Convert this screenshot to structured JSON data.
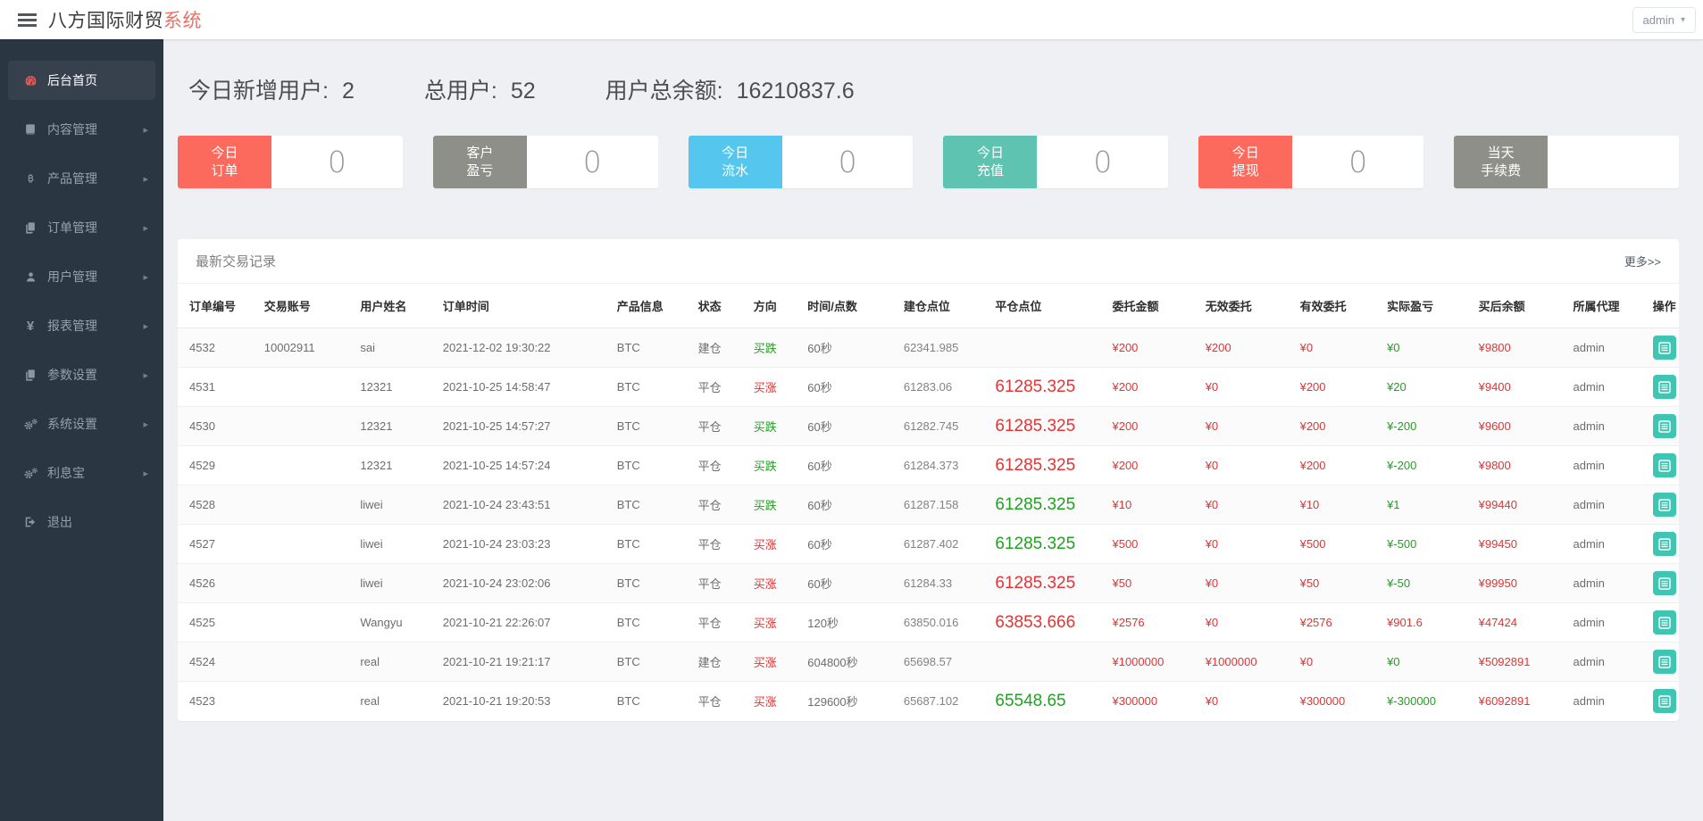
{
  "header": {
    "title_main": "八方国际财贸",
    "title_accent": "系统",
    "user_menu": "admin"
  },
  "sidebar": {
    "items": [
      {
        "id": "dashboard",
        "label": "后台首页",
        "icon": "dashboard-icon",
        "active": true,
        "has_children": false
      },
      {
        "id": "content",
        "label": "内容管理",
        "icon": "book-icon",
        "active": false,
        "has_children": true
      },
      {
        "id": "product",
        "label": "产品管理",
        "icon": "bitcoin-icon",
        "active": false,
        "has_children": true
      },
      {
        "id": "orders",
        "label": "订单管理",
        "icon": "copy-icon",
        "active": false,
        "has_children": true
      },
      {
        "id": "users",
        "label": "用户管理",
        "icon": "user-icon",
        "active": false,
        "has_children": true
      },
      {
        "id": "reports",
        "label": "报表管理",
        "icon": "yen-icon",
        "active": false,
        "has_children": true
      },
      {
        "id": "params",
        "label": "参数设置",
        "icon": "copy-icon",
        "active": false,
        "has_children": true
      },
      {
        "id": "system",
        "label": "系统设置",
        "icon": "gears-icon",
        "active": false,
        "has_children": true
      },
      {
        "id": "lixibao",
        "label": "利息宝",
        "icon": "gears-icon",
        "active": false,
        "has_children": true
      },
      {
        "id": "logout",
        "label": "退出",
        "icon": "signout-icon",
        "active": false,
        "has_children": false
      }
    ]
  },
  "stats": {
    "items": [
      {
        "label": "今日新增用户:",
        "value": "2"
      },
      {
        "label": "总用户:",
        "value": "52"
      },
      {
        "label": "用户总余额:",
        "value": "16210837.6"
      }
    ]
  },
  "cards": [
    {
      "id": "today-orders",
      "lines": [
        "今日",
        "订单"
      ],
      "value": "0",
      "color": "#fb6a5d"
    },
    {
      "id": "client-pnl",
      "lines": [
        "客户",
        "盈亏"
      ],
      "value": "0",
      "color": "#8f8f8a"
    },
    {
      "id": "today-turnover",
      "lines": [
        "今日",
        "流水"
      ],
      "value": "0",
      "color": "#55c7ee"
    },
    {
      "id": "today-deposit",
      "lines": [
        "今日",
        "充值"
      ],
      "value": "0",
      "color": "#5fc3b2"
    },
    {
      "id": "today-withdraw",
      "lines": [
        "今日",
        "提现"
      ],
      "value": "0",
      "color": "#fb6a5d"
    },
    {
      "id": "today-fees",
      "lines": [
        "当天",
        "手续费"
      ],
      "value": "",
      "color": "#8f8f8a"
    }
  ],
  "colors": {
    "red_text": "#e23434",
    "green_text": "#21a121",
    "action_button": "#3fc6b2"
  },
  "panel": {
    "title": "最新交易记录",
    "more_label": "更多>>",
    "columns": [
      "订单编号",
      "交易账号",
      "用户姓名",
      "订单时间",
      "产品信息",
      "状态",
      "方向",
      "时间/点数",
      "建仓点位",
      "平仓点位",
      "委托金额",
      "无效委托",
      "有效委托",
      "实际盈亏",
      "买后余额",
      "所属代理",
      "操作"
    ],
    "rows": [
      {
        "id": "4532",
        "account": "10002911",
        "username": "sai",
        "time": "2021-12-02 19:30:22",
        "product": "BTC",
        "status": "建仓",
        "direction": "买跌",
        "direction_color": "green",
        "duration": "60秒",
        "open": "62341.985",
        "close": "",
        "close_color": "red",
        "amount": "¥200",
        "invalid": "¥200",
        "valid": "¥0",
        "profit": "¥0",
        "profit_color": "green",
        "balance": "¥9800",
        "agent": "admin"
      },
      {
        "id": "4531",
        "account": "",
        "username": "12321",
        "time": "2021-10-25 14:58:47",
        "product": "BTC",
        "status": "平仓",
        "direction": "买涨",
        "direction_color": "red",
        "duration": "60秒",
        "open": "61283.06",
        "close": "61285.325",
        "close_color": "red",
        "amount": "¥200",
        "invalid": "¥0",
        "valid": "¥200",
        "profit": "¥20",
        "profit_color": "green",
        "balance": "¥9400",
        "agent": "admin"
      },
      {
        "id": "4530",
        "account": "",
        "username": "12321",
        "time": "2021-10-25 14:57:27",
        "product": "BTC",
        "status": "平仓",
        "direction": "买跌",
        "direction_color": "green",
        "duration": "60秒",
        "open": "61282.745",
        "close": "61285.325",
        "close_color": "red",
        "amount": "¥200",
        "invalid": "¥0",
        "valid": "¥200",
        "profit": "¥-200",
        "profit_color": "green",
        "balance": "¥9600",
        "agent": "admin"
      },
      {
        "id": "4529",
        "account": "",
        "username": "12321",
        "time": "2021-10-25 14:57:24",
        "product": "BTC",
        "status": "平仓",
        "direction": "买跌",
        "direction_color": "green",
        "duration": "60秒",
        "open": "61284.373",
        "close": "61285.325",
        "close_color": "red",
        "amount": "¥200",
        "invalid": "¥0",
        "valid": "¥200",
        "profit": "¥-200",
        "profit_color": "green",
        "balance": "¥9800",
        "agent": "admin"
      },
      {
        "id": "4528",
        "account": "",
        "username": "liwei",
        "time": "2021-10-24 23:43:51",
        "product": "BTC",
        "status": "平仓",
        "direction": "买跌",
        "direction_color": "green",
        "duration": "60秒",
        "open": "61287.158",
        "close": "61285.325",
        "close_color": "green",
        "amount": "¥10",
        "invalid": "¥0",
        "valid": "¥10",
        "profit": "¥1",
        "profit_color": "green",
        "balance": "¥99440",
        "agent": "admin"
      },
      {
        "id": "4527",
        "account": "",
        "username": "liwei",
        "time": "2021-10-24 23:03:23",
        "product": "BTC",
        "status": "平仓",
        "direction": "买涨",
        "direction_color": "red",
        "duration": "60秒",
        "open": "61287.402",
        "close": "61285.325",
        "close_color": "green",
        "amount": "¥500",
        "invalid": "¥0",
        "valid": "¥500",
        "profit": "¥-500",
        "profit_color": "green",
        "balance": "¥99450",
        "agent": "admin"
      },
      {
        "id": "4526",
        "account": "",
        "username": "liwei",
        "time": "2021-10-24 23:02:06",
        "product": "BTC",
        "status": "平仓",
        "direction": "买涨",
        "direction_color": "red",
        "duration": "60秒",
        "open": "61284.33",
        "close": "61285.325",
        "close_color": "red",
        "amount": "¥50",
        "invalid": "¥0",
        "valid": "¥50",
        "profit": "¥-50",
        "profit_color": "green",
        "balance": "¥99950",
        "agent": "admin"
      },
      {
        "id": "4525",
        "account": "",
        "username": "Wangyu",
        "time": "2021-10-21 22:26:07",
        "product": "BTC",
        "status": "平仓",
        "direction": "买涨",
        "direction_color": "red",
        "duration": "120秒",
        "open": "63850.016",
        "close": "63853.666",
        "close_color": "red",
        "amount": "¥2576",
        "invalid": "¥0",
        "valid": "¥2576",
        "profit": "¥901.6",
        "profit_color": "red",
        "balance": "¥47424",
        "agent": "admin"
      },
      {
        "id": "4524",
        "account": "",
        "username": "real",
        "time": "2021-10-21 19:21:17",
        "product": "BTC",
        "status": "建仓",
        "direction": "买涨",
        "direction_color": "red",
        "duration": "604800秒",
        "open": "65698.57",
        "close": "",
        "close_color": "red",
        "amount": "¥1000000",
        "invalid": "¥1000000",
        "valid": "¥0",
        "profit": "¥0",
        "profit_color": "green",
        "balance": "¥5092891",
        "agent": "admin"
      },
      {
        "id": "4523",
        "account": "",
        "username": "real",
        "time": "2021-10-21 19:20:53",
        "product": "BTC",
        "status": "平仓",
        "direction": "买涨",
        "direction_color": "red",
        "duration": "129600秒",
        "open": "65687.102",
        "close": "65548.65",
        "close_color": "green",
        "amount": "¥300000",
        "invalid": "¥0",
        "valid": "¥300000",
        "profit": "¥-300000",
        "profit_color": "green",
        "balance": "¥6092891",
        "agent": "admin"
      }
    ]
  }
}
